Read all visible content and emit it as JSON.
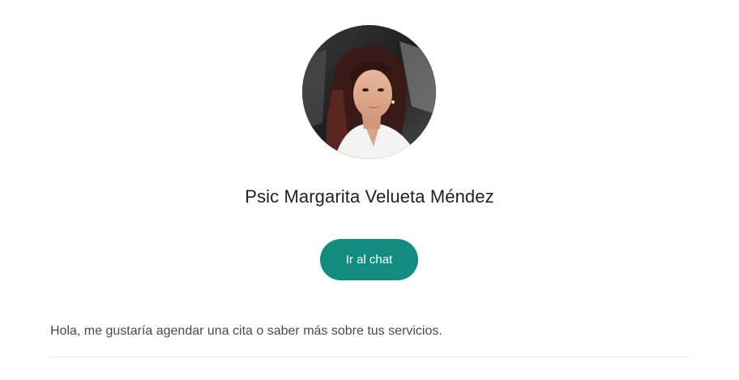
{
  "profile": {
    "name": "Psic Margarita Velueta Méndez"
  },
  "actions": {
    "chat_label": "Ir al chat"
  },
  "message": {
    "text": "Hola, me gustaría agendar una cita o saber más sobre tus servicios."
  },
  "colors": {
    "accent": "#128c7e",
    "background": "#ffffff",
    "text_primary": "#1f1f1f",
    "text_secondary": "#4a4a4a"
  }
}
